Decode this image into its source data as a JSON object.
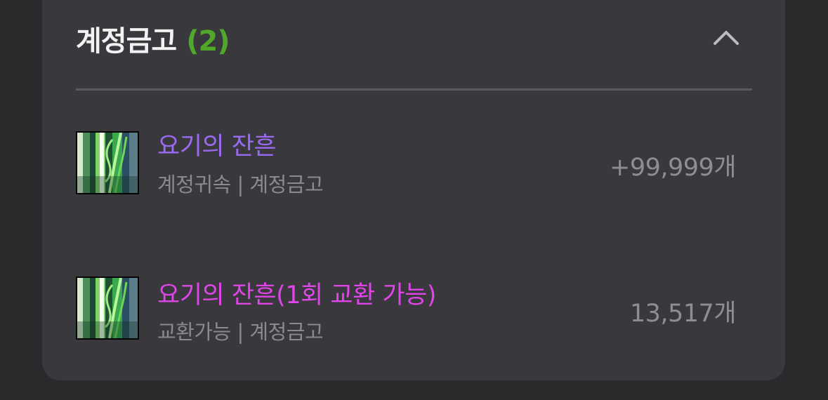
{
  "section": {
    "title": "계정금고",
    "count": "(2)",
    "count_color": "#4fa82a",
    "collapse_icon": "chevron-up-icon"
  },
  "items": [
    {
      "name": "요기의 잔흔",
      "name_color": "#9b6af2",
      "subtitle": "계정귀속 | 계정금고",
      "quantity": "+99,999개",
      "icon": "item-thumbnail"
    },
    {
      "name": "요기의 잔흔(1회 교환 가능)",
      "name_color": "#e045e8",
      "subtitle": "교환가능 | 계정금고",
      "quantity": "13,517개",
      "icon": "item-thumbnail"
    }
  ]
}
